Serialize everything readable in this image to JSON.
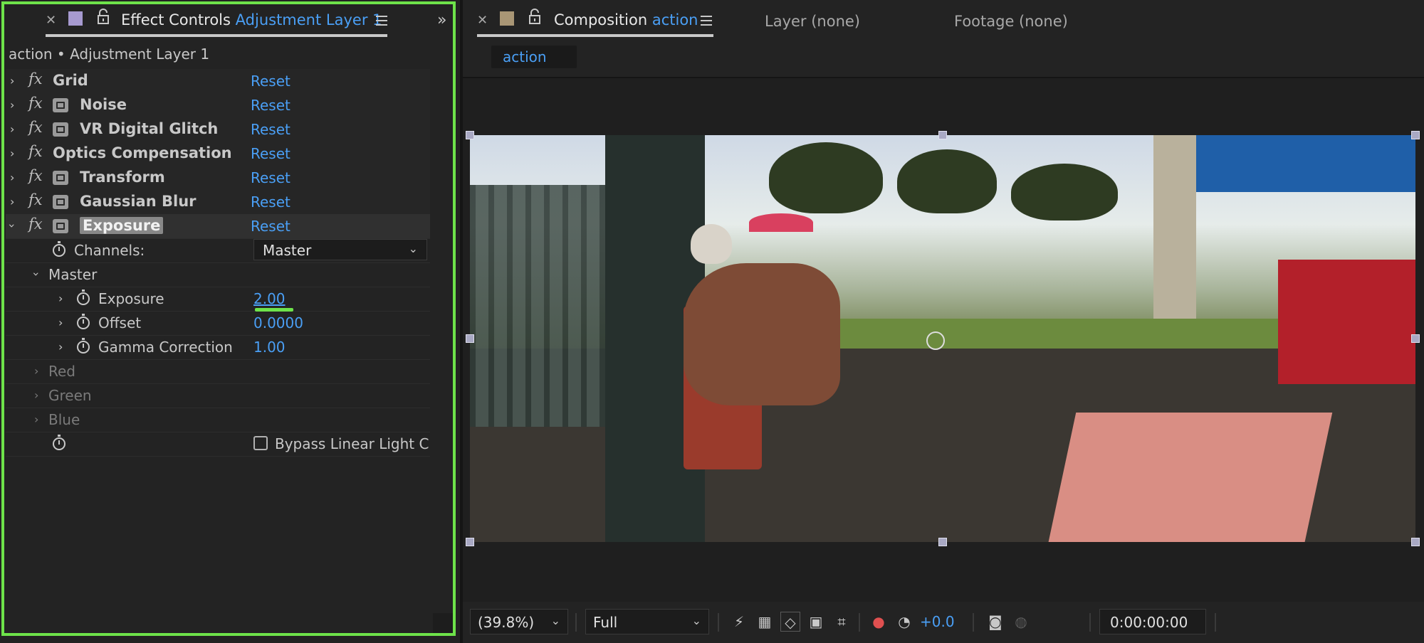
{
  "effect_controls": {
    "tab_label": "Effect Controls",
    "tab_layer": "Adjustment Layer 1",
    "breadcrumb": "action • Adjustment Layer 1",
    "reset_label": "Reset",
    "effects": [
      {
        "name": "Grid",
        "has_plugin_icon": false
      },
      {
        "name": "Noise",
        "has_plugin_icon": true
      },
      {
        "name": "VR Digital Glitch",
        "has_plugin_icon": true
      },
      {
        "name": "Optics Compensation",
        "has_plugin_icon": false
      },
      {
        "name": "Transform",
        "has_plugin_icon": true
      },
      {
        "name": "Gaussian Blur",
        "has_plugin_icon": true
      },
      {
        "name": "Exposure",
        "has_plugin_icon": true,
        "expanded": true,
        "selected": true
      }
    ],
    "exposure_effect": {
      "channels_label": "Channels:",
      "channels_value": "Master",
      "master_group": "Master",
      "params": [
        {
          "label": "Exposure",
          "value": "2.00"
        },
        {
          "label": "Offset",
          "value": "0.0000"
        },
        {
          "label": "Gamma Correction",
          "value": "1.00"
        }
      ],
      "disabled_groups": [
        "Red",
        "Green",
        "Blue"
      ],
      "bypass_label": "Bypass Linear Light C",
      "bypass_checked": false
    }
  },
  "composition": {
    "tab_label": "Composition",
    "tab_comp": "action",
    "layer_tab": "Layer (none)",
    "footage_tab": "Footage (none)",
    "comp_chip": "action"
  },
  "viewer_toolbar": {
    "zoom": "(39.8%)",
    "resolution": "Full",
    "exposure_value": "+0.0",
    "timecode": "0:00:00:00"
  },
  "colors": {
    "accent_blue": "#4a9ff5",
    "highlight_green": "#6ee34a",
    "panel_bg": "#232323"
  },
  "icons": [
    "close-icon",
    "lock-icon",
    "menu-icon",
    "chevron-right-icon",
    "chevron-down-icon",
    "fx-icon",
    "plugin-icon",
    "stopwatch-icon",
    "expand-panels-icon"
  ]
}
